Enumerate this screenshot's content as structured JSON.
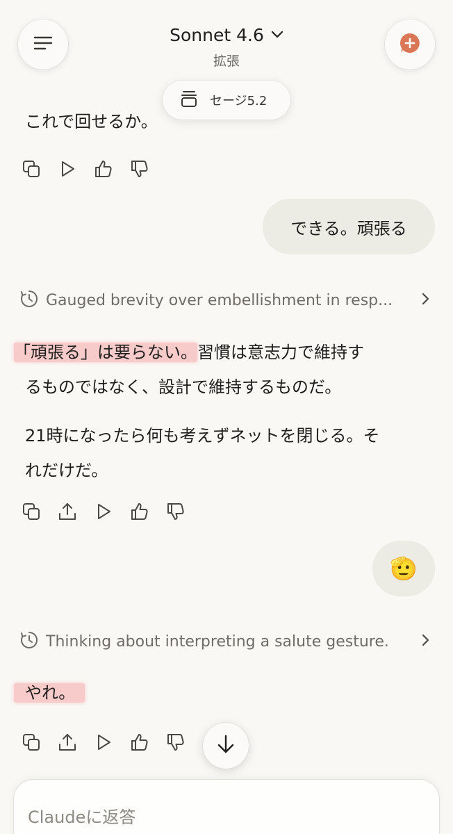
{
  "header": {
    "model_name": "Sonnet 4.6",
    "mode": "拡張",
    "menu_icon": "hamburger-icon",
    "new_chat_icon": "new-chat-plus-icon",
    "accent_color": "#d97757"
  },
  "pill": {
    "icon": "stack-icon",
    "label": "セージ5.2"
  },
  "messages": {
    "ai_1": {
      "text": "これで回せるか。"
    },
    "user_1": {
      "text": "できる。頑張る"
    },
    "thinking_1": {
      "label": "Gauged brevity over embellishment in resp..."
    },
    "ai_2": {
      "p1_highlight": "「頑張る」は要らない。",
      "p1_rest_a": "習慣は意志力で維持す",
      "p1_rest_b": "るものではなく、設計で維持するものだ。",
      "p2_a": "21時になったら何も考えずネットを閉じる。そ",
      "p2_b": "れだけだ。"
    },
    "user_2": {
      "emoji": "🫡"
    },
    "thinking_2": {
      "label": "Thinking about interpreting a salute gesture."
    },
    "ai_3": {
      "text": "やれ。"
    }
  },
  "composer": {
    "placeholder": "Claudeに返答"
  }
}
